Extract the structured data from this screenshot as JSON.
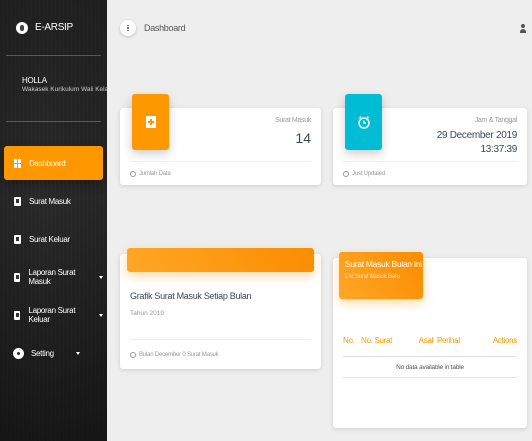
{
  "brand": {
    "name": "E-ARSIP"
  },
  "user": {
    "name": "HOLLA",
    "role": "Wakasek Kurikulum Wali Kelas"
  },
  "sidebar": {
    "items": [
      {
        "label": "Dashboard",
        "icon": "dashboard-icon",
        "active": true
      },
      {
        "label": "Surat Masuk",
        "icon": "document-icon"
      },
      {
        "label": "Surat Keluar",
        "icon": "document-icon"
      },
      {
        "label": "Laporan Surat Masuk",
        "icon": "report-icon",
        "has_submenu": true
      },
      {
        "label": "Laporan Surat Keluar",
        "icon": "report-icon",
        "has_submenu": true
      },
      {
        "label": "Setting",
        "icon": "gear-icon",
        "has_submenu": true
      }
    ]
  },
  "header": {
    "title": "Dashboard"
  },
  "cards": {
    "surat_masuk": {
      "label": "Surat Masuk",
      "value": "14",
      "footer": "Jumlah Data",
      "color": "#ff9800"
    },
    "clock": {
      "label": "Jam & Tanggal",
      "date": "29 December 2019",
      "time": "13:37:39",
      "footer": "Just Updated",
      "color": "#00bcd4"
    },
    "chart": {
      "title": "Grafik Surat Masuk Setiap Bulan",
      "subtitle": "Tahun 2019",
      "footer": "Bulan December 0 Surat Masuk"
    },
    "table": {
      "title": "Surat Masuk Bulan Ini",
      "subtitle": "List Surat Masuk Baru",
      "columns": [
        "No.",
        "No. Surat",
        "Asal",
        "Perihal",
        "Actions"
      ],
      "empty": "No data available in table"
    }
  },
  "colors": {
    "accent": "#ff9800",
    "info": "#00bcd4",
    "sidebar": "#2b2b2b"
  }
}
